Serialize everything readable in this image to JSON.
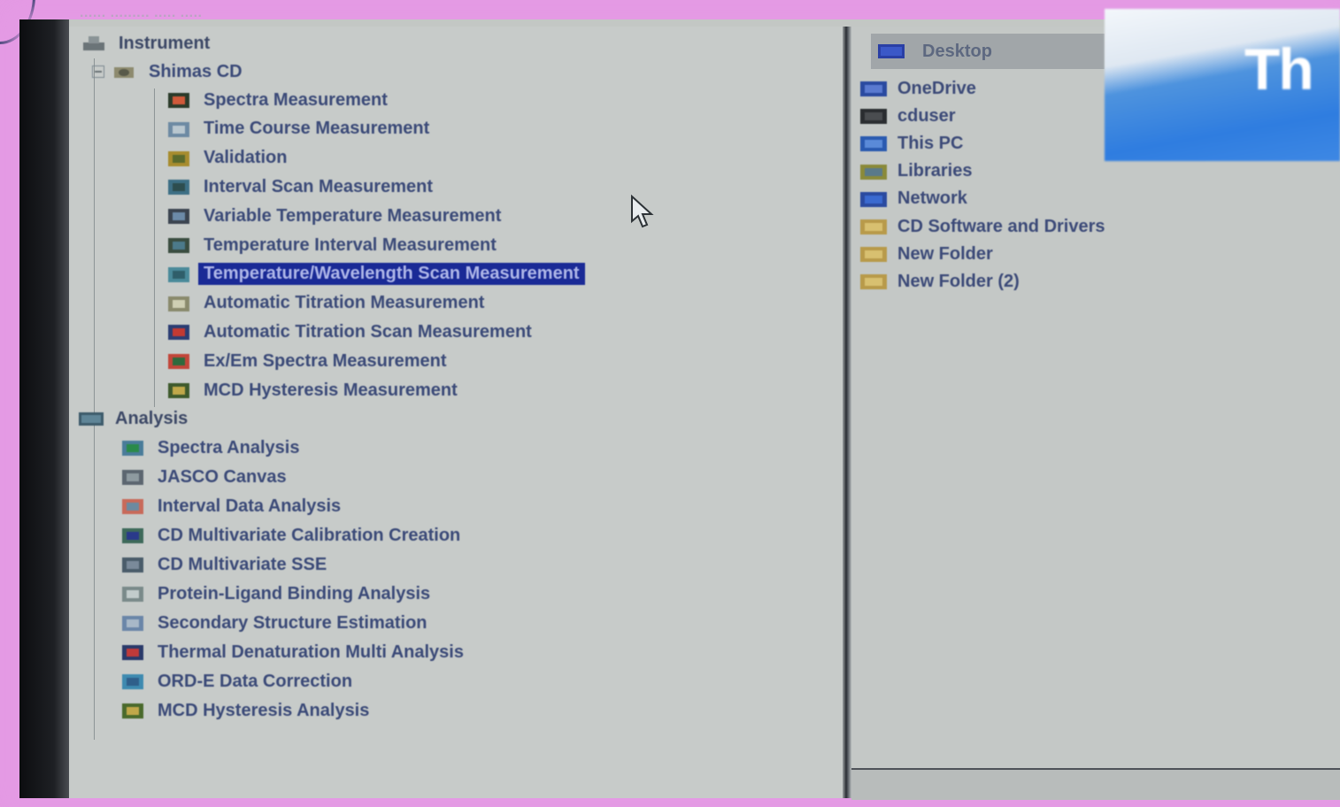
{
  "menu_strip": "...... ......... ..... .....",
  "tree": {
    "instrument_label": "Instrument",
    "device_label": "Shimas CD",
    "measurements": [
      {
        "label": "Spectra Measurement",
        "icon": "spectra-icon"
      },
      {
        "label": "Time Course Measurement",
        "icon": "time-course-icon"
      },
      {
        "label": "Validation",
        "icon": "validation-icon"
      },
      {
        "label": "Interval Scan Measurement",
        "icon": "interval-scan-icon"
      },
      {
        "label": "Variable Temperature Measurement",
        "icon": "variable-temperature-icon"
      },
      {
        "label": "Temperature Interval Measurement",
        "icon": "temperature-interval-icon"
      },
      {
        "label": "Temperature/Wavelength Scan Measurement",
        "icon": "temperature-wavelength-icon",
        "selected": true
      },
      {
        "label": "Automatic Titration Measurement",
        "icon": "titration-icon"
      },
      {
        "label": "Automatic Titration Scan Measurement",
        "icon": "titration-scan-icon"
      },
      {
        "label": "Ex/Em Spectra Measurement",
        "icon": "ex-em-icon"
      },
      {
        "label": "MCD Hysteresis Measurement",
        "icon": "mcd-icon"
      }
    ],
    "analysis_label": "Analysis",
    "analyses": [
      {
        "label": "Spectra Analysis",
        "icon": "spectra-analysis-icon"
      },
      {
        "label": "JASCO Canvas",
        "icon": "canvas-icon"
      },
      {
        "label": "Interval Data Analysis",
        "icon": "interval-data-icon"
      },
      {
        "label": "CD Multivariate Calibration Creation",
        "icon": "multivariate-calibration-icon"
      },
      {
        "label": "CD Multivariate SSE",
        "icon": "multivariate-sse-icon"
      },
      {
        "label": "Protein-Ligand Binding Analysis",
        "icon": "binding-icon"
      },
      {
        "label": "Secondary Structure Estimation",
        "icon": "secondary-structure-icon"
      },
      {
        "label": "Thermal Denaturation Multi Analysis",
        "icon": "thermal-icon"
      },
      {
        "label": "ORD-E Data Correction",
        "icon": "ord-icon"
      },
      {
        "label": "MCD Hysteresis Analysis",
        "icon": "mcd-analysis-icon"
      }
    ]
  },
  "explorer": {
    "header": "Desktop",
    "items": [
      {
        "label": "OneDrive",
        "icon": "cloud-icon"
      },
      {
        "label": "cduser",
        "icon": "user-icon"
      },
      {
        "label": "This PC",
        "icon": "computer-icon"
      },
      {
        "label": "Libraries",
        "icon": "library-icon"
      },
      {
        "label": "Network",
        "icon": "network-icon"
      },
      {
        "label": "CD Software and Drivers",
        "icon": "folder-icon"
      },
      {
        "label": "New Folder",
        "icon": "folder-icon"
      },
      {
        "label": "New Folder (2)",
        "icon": "folder-icon"
      }
    ]
  },
  "wallpaper_text": "Th",
  "colors": {
    "selection": "#1a2a96",
    "text": "#3b4a78",
    "pane": "#c7cbc9",
    "border_glow": "#e49ae4"
  }
}
